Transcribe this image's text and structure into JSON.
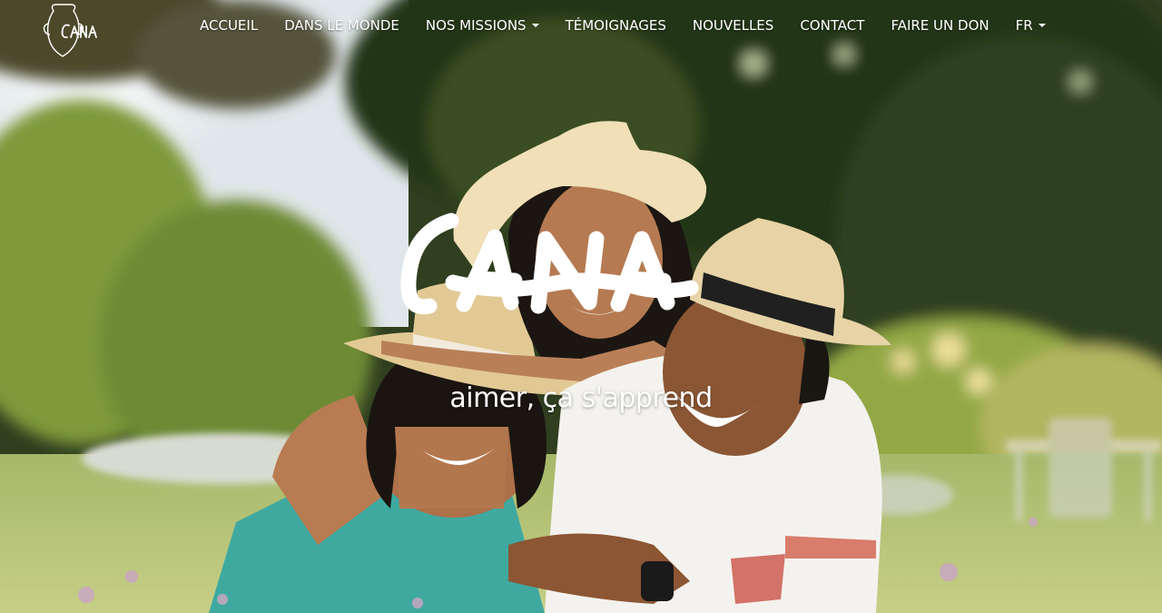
{
  "brand": {
    "logo_text": "CANA",
    "wordmark_text": "CANA",
    "tagline": "aimer, ça s'apprend"
  },
  "nav": {
    "items": [
      {
        "label": "ACCUEIL",
        "dropdown": false
      },
      {
        "label": "DANS LE MONDE",
        "dropdown": false
      },
      {
        "label": "NOS MISSIONS",
        "dropdown": true
      },
      {
        "label": "TÉMOIGNAGES",
        "dropdown": false
      },
      {
        "label": "NOUVELLES",
        "dropdown": false
      },
      {
        "label": "CONTACT",
        "dropdown": false
      },
      {
        "label": "FAIRE UN DON",
        "dropdown": false
      },
      {
        "label": "FR",
        "dropdown": true
      }
    ]
  },
  "colors": {
    "text": "#ffffff"
  }
}
